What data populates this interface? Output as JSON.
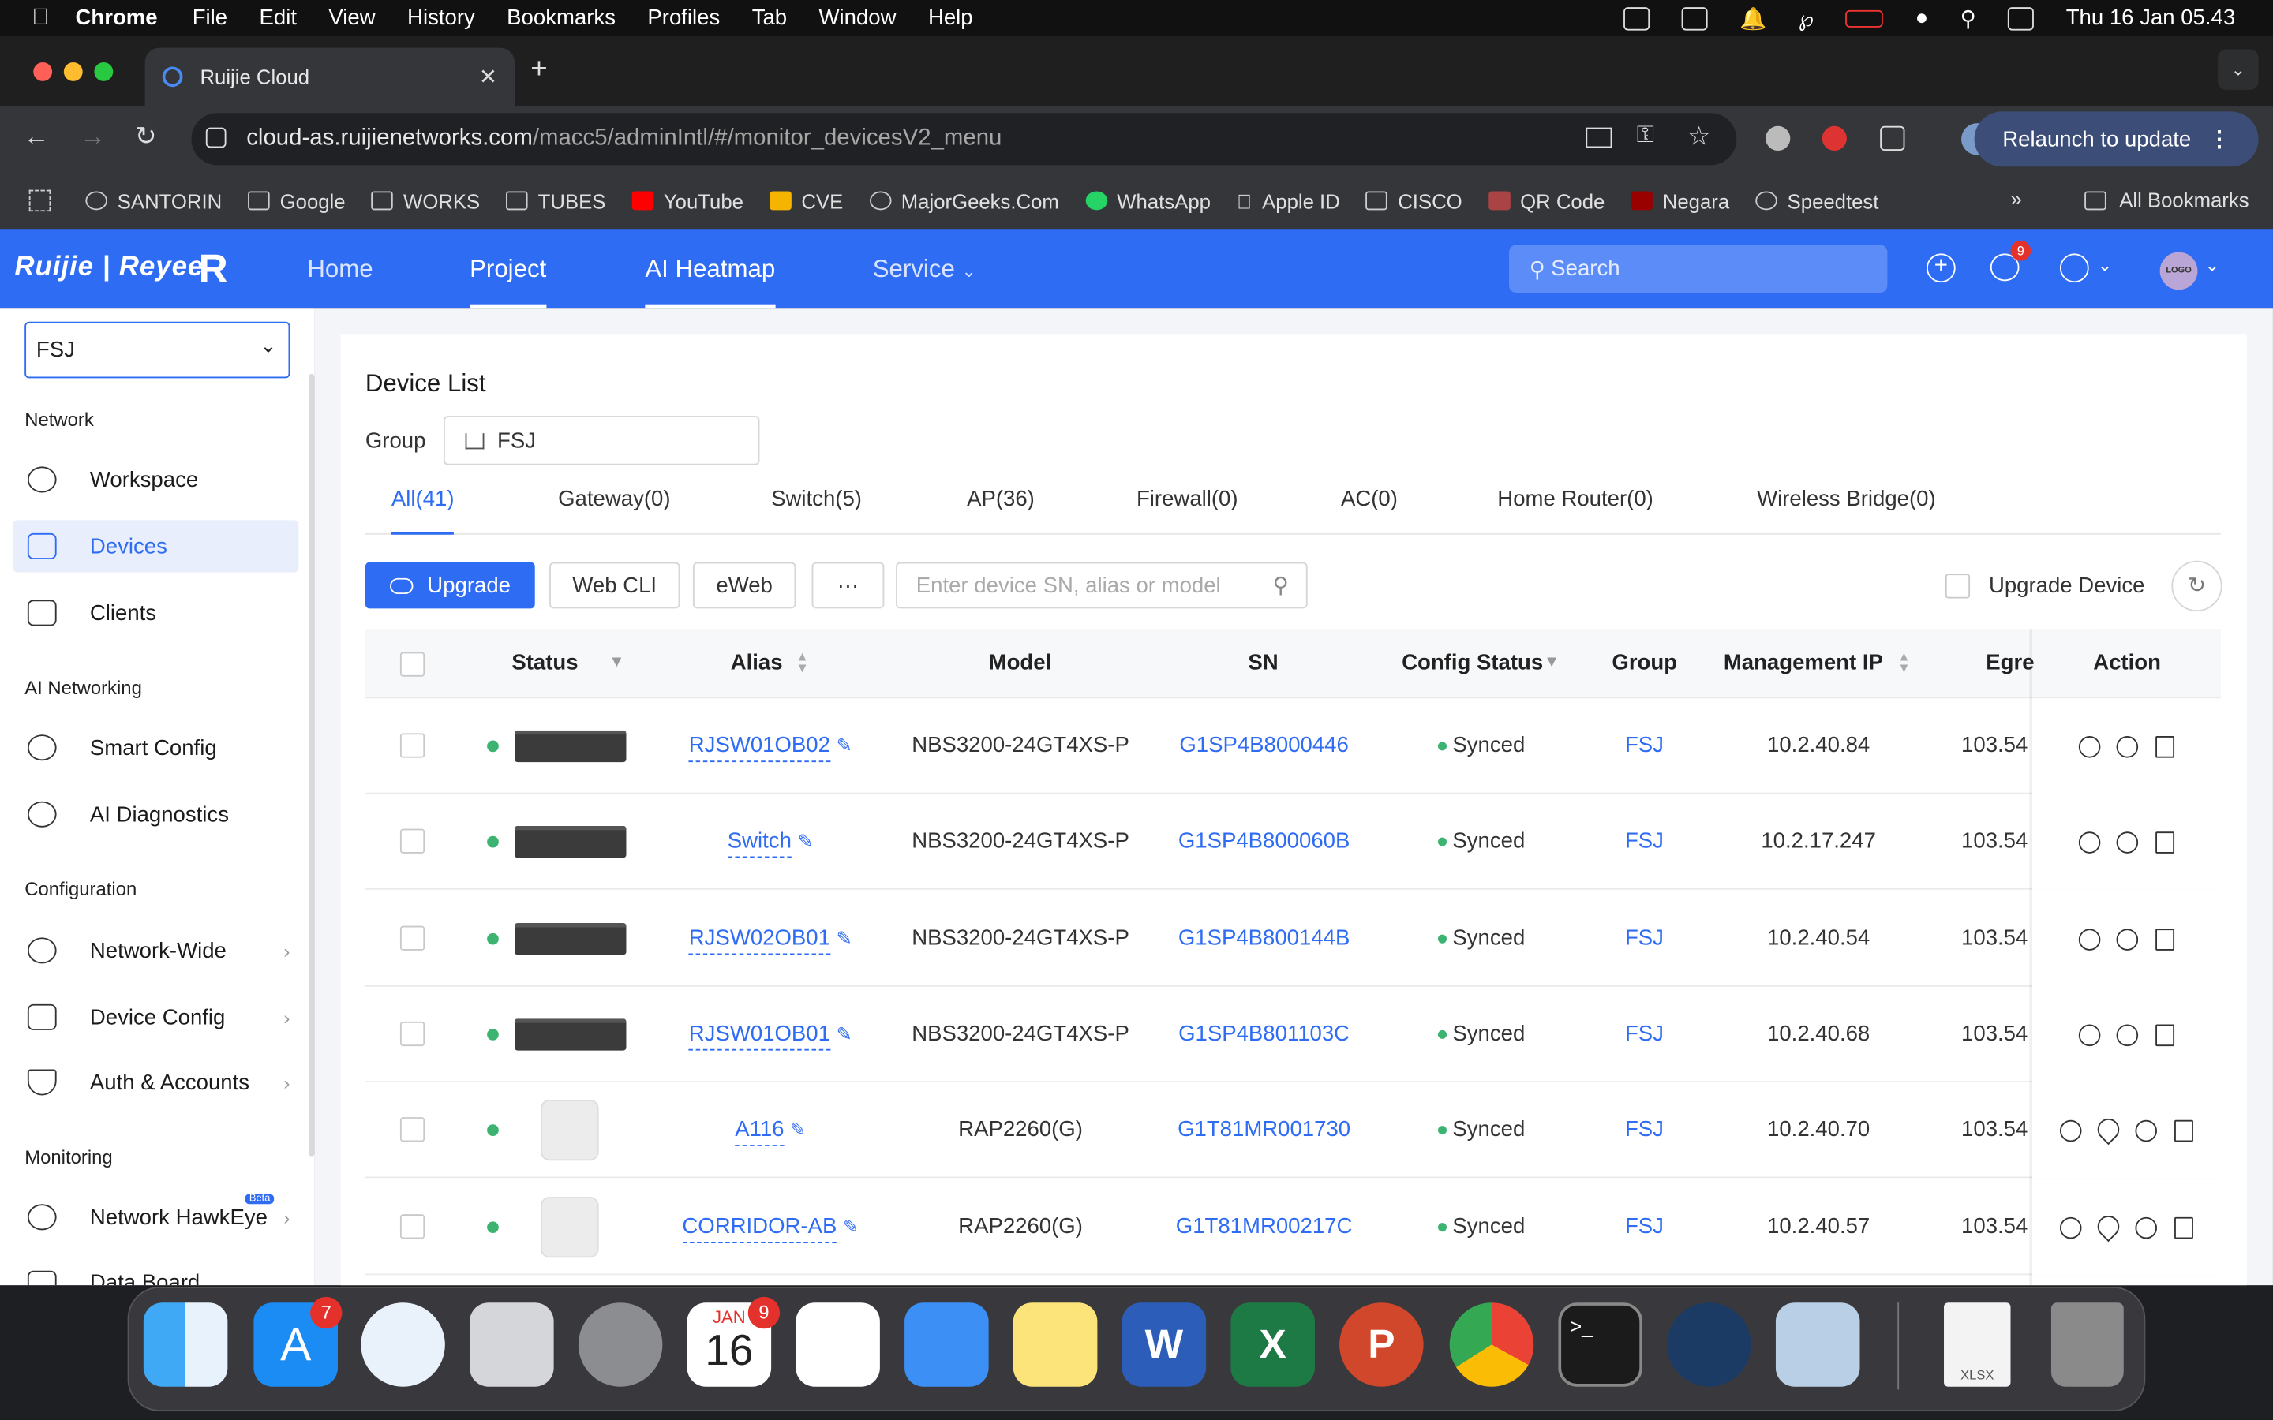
{
  "menubar": {
    "app": "Chrome",
    "items": [
      "File",
      "Edit",
      "View",
      "History",
      "Bookmarks",
      "Profiles",
      "Tab",
      "Window",
      "Help"
    ],
    "clock": "Thu 16 Jan  05.43"
  },
  "browser": {
    "tab_title": "Ruijie Cloud",
    "url_host": "cloud-as.ruijienetworks.com",
    "url_path": "/macc5/adminIntl/#/monitor_devicesV2_menu",
    "relaunch": "Relaunch to update",
    "bookmarks": [
      "SANTORIN",
      "Google",
      "WORKS",
      "TUBES",
      "YouTube",
      "CVE",
      "MajorGeeks.Com",
      "WhatsApp",
      "Apple ID",
      "CISCO",
      "QR Code",
      "Negara",
      "Speedtest"
    ],
    "all_bookmarks": "All Bookmarks"
  },
  "header": {
    "logo": "Ruijie | Reyee",
    "nav": [
      "Home",
      "Project",
      "AI Heatmap",
      "Service"
    ],
    "search_placeholder": "Search",
    "notif_count": "9",
    "avatar": "LOGO"
  },
  "sidebar": {
    "project": "FSJ",
    "sections": {
      "network": "Network",
      "ai": "AI Networking",
      "config": "Configuration",
      "monitoring": "Monitoring"
    },
    "items": {
      "workspace": "Workspace",
      "devices": "Devices",
      "clients": "Clients",
      "smart_config": "Smart Config",
      "ai_diag": "AI Diagnostics",
      "network_wide": "Network-Wide",
      "device_config": "Device Config",
      "auth": "Auth & Accounts",
      "hawkeye": "Network HawkEye",
      "hawkeye_badge": "Beta",
      "data_board": "Data Board"
    }
  },
  "device_list": {
    "title": "Device List",
    "group_label": "Group",
    "group_value": "FSJ",
    "tabs": [
      "All(41)",
      "Gateway(0)",
      "Switch(5)",
      "AP(36)",
      "Firewall(0)",
      "AC(0)",
      "Home Router(0)",
      "Wireless Bridge(0)"
    ],
    "buttons": {
      "upgrade": "Upgrade",
      "webcli": "Web CLI",
      "eweb": "eWeb",
      "more": "···"
    },
    "search_placeholder": "Enter device SN, alias or model",
    "upgrade_device": "Upgrade Device",
    "columns": [
      "Status",
      "Alias",
      "Model",
      "SN",
      "Config Status",
      "Group",
      "Management IP",
      "Egre",
      "Action"
    ],
    "rows": [
      {
        "type": "switch",
        "alias": "RJSW01OB02",
        "model": "NBS3200-24GT4XS-P",
        "sn": "G1SP4B8000446",
        "config": "Synced",
        "group": "FSJ",
        "ip": "10.2.40.84",
        "egress": "103.54"
      },
      {
        "type": "switch",
        "alias": "Switch",
        "model": "NBS3200-24GT4XS-P",
        "sn": "G1SP4B800060B",
        "config": "Synced",
        "group": "FSJ",
        "ip": "10.2.17.247",
        "egress": "103.54"
      },
      {
        "type": "switch",
        "alias": "RJSW02OB01",
        "model": "NBS3200-24GT4XS-P",
        "sn": "G1SP4B800144B",
        "config": "Synced",
        "group": "FSJ",
        "ip": "10.2.40.54",
        "egress": "103.54"
      },
      {
        "type": "switch",
        "alias": "RJSW01OB01",
        "model": "NBS3200-24GT4XS-P",
        "sn": "G1SP4B801103C",
        "config": "Synced",
        "group": "FSJ",
        "ip": "10.2.40.68",
        "egress": "103.54"
      },
      {
        "type": "ap",
        "alias": "A116",
        "model": "RAP2260(G)",
        "sn": "G1T81MR001730",
        "config": "Synced",
        "group": "FSJ",
        "ip": "10.2.40.70",
        "egress": "103.54"
      },
      {
        "type": "ap",
        "alias": "CORRIDOR-AB",
        "model": "RAP2260(G)",
        "sn": "G1T81MR00217C",
        "config": "Synced",
        "group": "FSJ",
        "ip": "10.2.40.57",
        "egress": "103.54"
      }
    ]
  },
  "dock": {
    "appstore_badge": "7",
    "calendar_month": "JAN",
    "calendar_day": "16",
    "calendar_badge": "9",
    "file_label": "XLSX"
  }
}
